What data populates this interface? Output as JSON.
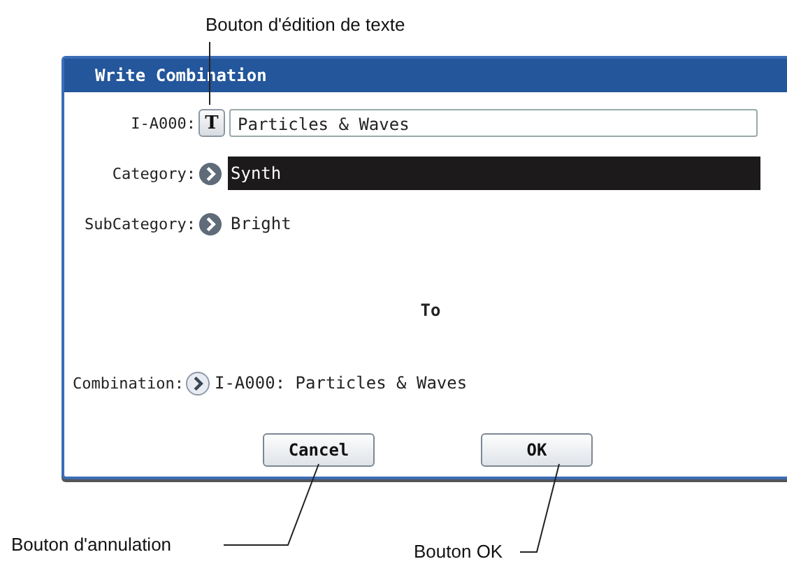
{
  "annotations": [
    {
      "text": "Bouton d'édition de texte"
    },
    {
      "text": "Bouton d'annulation"
    },
    {
      "text": "Bouton OK"
    }
  ],
  "dialog": {
    "title": "Write Combination",
    "name_label": "I-A000:",
    "edit_button": "T",
    "name_value": "Particles & Waves",
    "fields": [
      {
        "label": "Category:",
        "value": "Synth",
        "selected": true
      },
      {
        "label": "SubCategory:",
        "value": "Bright",
        "selected": false
      }
    ],
    "to_label": "To",
    "destination": {
      "label": "Combination:",
      "value": "I-A000: Particles & Waves"
    },
    "buttons": [
      "Cancel",
      "OK"
    ]
  }
}
